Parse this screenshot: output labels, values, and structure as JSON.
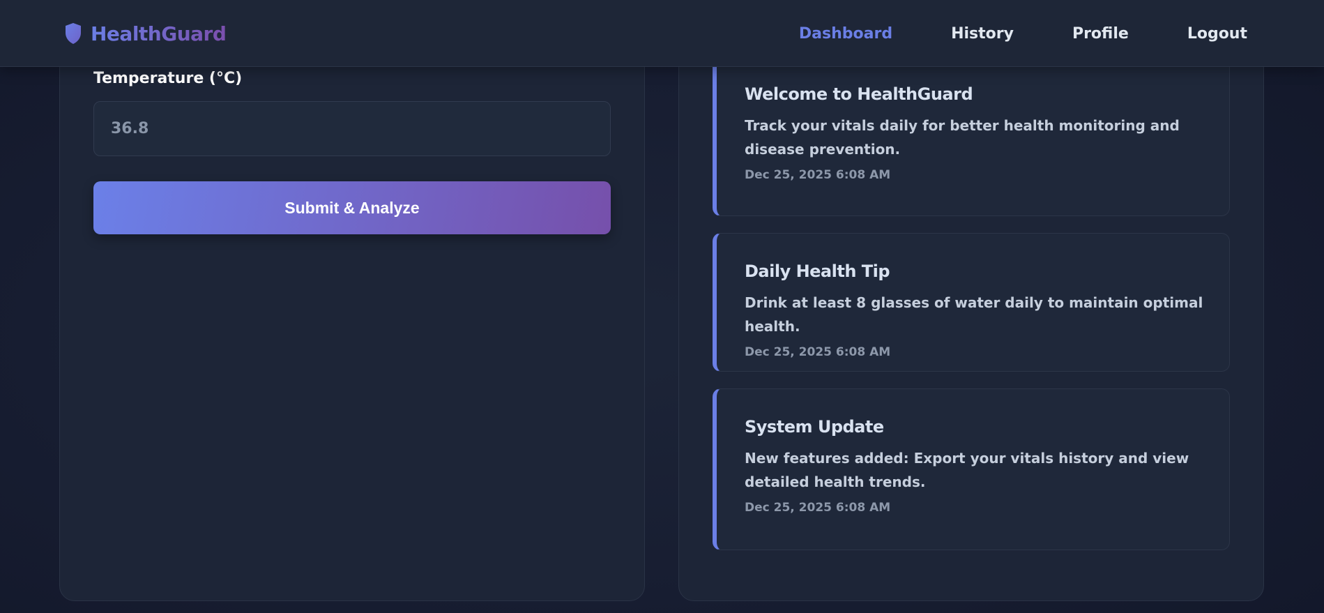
{
  "header": {
    "brand": "HealthGuard",
    "brand_icon": "shield-icon",
    "nav": [
      {
        "label": "Dashboard",
        "active": true
      },
      {
        "label": "History",
        "active": false
      },
      {
        "label": "Profile",
        "active": false
      },
      {
        "label": "Logout",
        "active": false
      }
    ]
  },
  "form": {
    "temperature_label": "Temperature (°C)",
    "temperature_placeholder": "36.8",
    "submit_label": "Submit & Analyze"
  },
  "notifications": [
    {
      "title": "Welcome to HealthGuard",
      "body": "Track your vitals daily for better health monitoring and disease prevention.",
      "time": "Dec 25, 2025 6:08 AM"
    },
    {
      "title": "Daily Health Tip",
      "body": "Drink at least 8 glasses of water daily to maintain optimal health.",
      "time": "Dec 25, 2025 6:08 AM"
    },
    {
      "title": "System Update",
      "body": "New features added: Export your vitals history and view detailed health trends.",
      "time": "Dec 25, 2025 6:08 AM"
    }
  ],
  "colors": {
    "accent": "#6b7fe6",
    "accent_end": "#7650ab",
    "background": "#161c30",
    "panel": "#1d2537"
  }
}
